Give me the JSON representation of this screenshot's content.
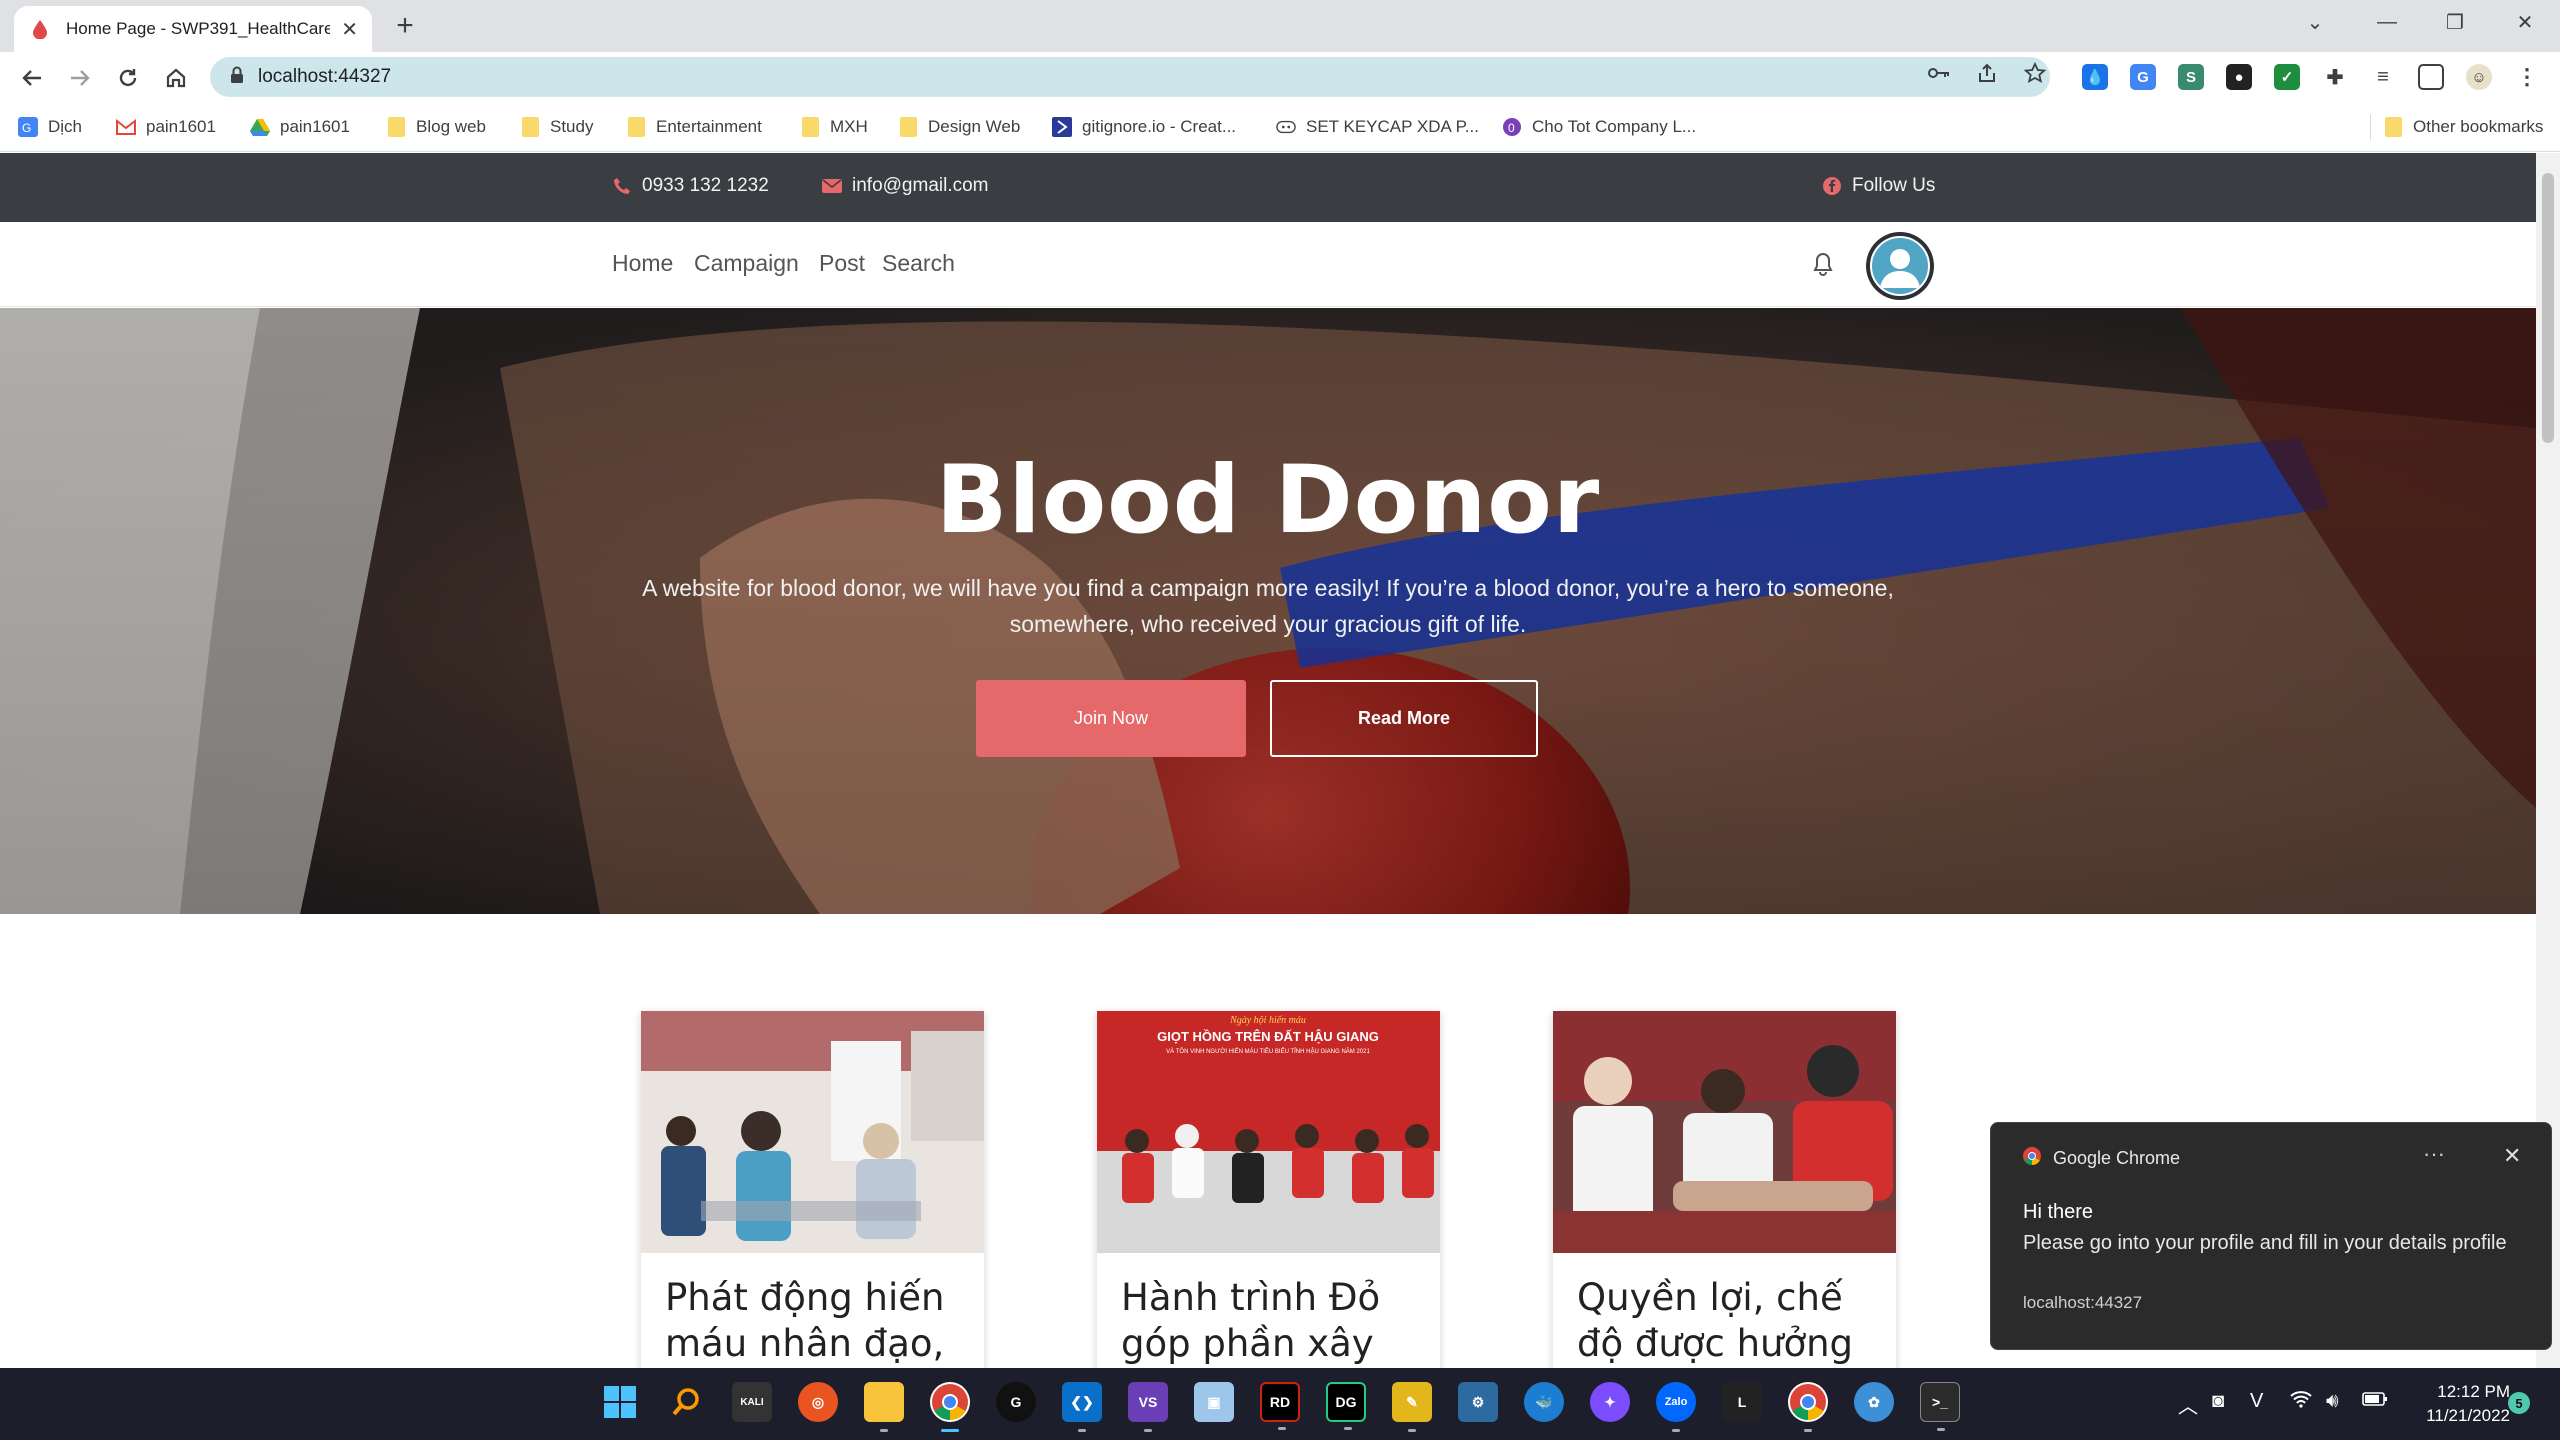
{
  "browser": {
    "tab_title": "Home Page - SWP391_HealthCare",
    "url": "localhost:44327",
    "bookmarks": [
      "Dịch",
      "pain1601",
      "pain1601",
      "Blog web",
      "Study",
      "Entertainment",
      "MXH",
      "Design Web",
      "gitignore.io - Creat...",
      "SET KEYCAP XDA P...",
      "Cho Tot Company L..."
    ],
    "other_bookmarks": "Other bookmarks"
  },
  "topbar": {
    "phone": "0933 132 1232",
    "email": "info@gmail.com",
    "follow": "Follow Us"
  },
  "nav": {
    "items": [
      "Home",
      "Campaign",
      "Post",
      "Search"
    ]
  },
  "hero": {
    "title": "Blood Donor",
    "subtitle": "A website for blood donor, we will have you find a campaign more easily! If you’re a blood donor, you’re a hero to someone, somewhere, who received your gracious gift of life.",
    "join_label": "Join Now",
    "more_label": "Read More"
  },
  "cards": [
    {
      "title": "Phát động hiến máu nhân đạo,"
    },
    {
      "title": "Hành trình Đỏ góp phần xây"
    },
    {
      "title": "Quyền lợi, chế độ được hưởng"
    }
  ],
  "card2_poster": {
    "line1": "Ngày hội hiến máu",
    "line2": "GIỌT HỒNG TRÊN ĐẤT HẬU GIANG",
    "line3": "VÀ TÔN VINH NGƯỜI HIẾN MÁU TIÊU BIỂU TỈNH HẬU GIANG NĂM 2021"
  },
  "notification": {
    "app": "Google Chrome",
    "title": "Hi there",
    "body": "Please go into your profile and fill in your details profile",
    "source": "localhost:44327"
  },
  "taskbar": {
    "time": "12:12 PM",
    "date": "11/21/2022",
    "badge": "5"
  },
  "colors": {
    "accent": "#e5686a",
    "topbar": "#3a3d41",
    "omnibox": "#cde6ec"
  }
}
